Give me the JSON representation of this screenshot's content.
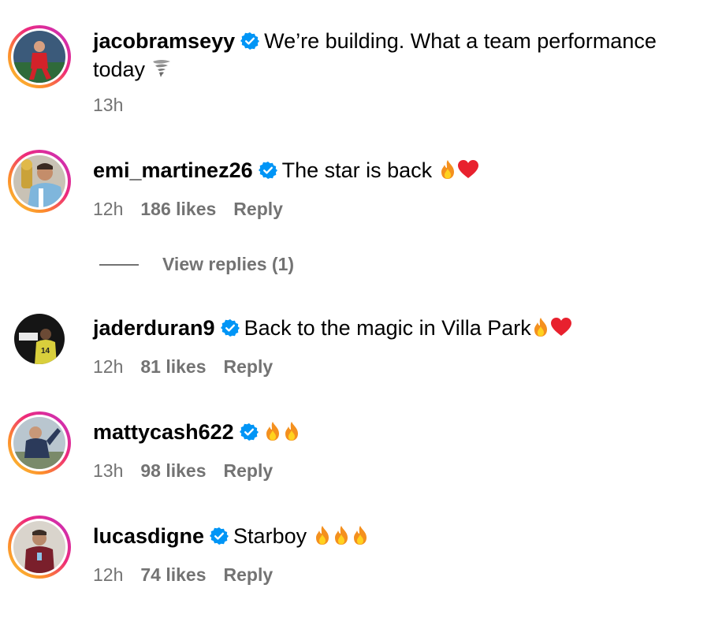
{
  "comments": [
    {
      "username": "jacobramseyy",
      "text": "We’re building. What a team performance",
      "text_cont": "today",
      "trailing_icon": "tornado-icon",
      "time": "13h",
      "likes": "",
      "reply": ""
    },
    {
      "username": "emi_martinez26",
      "text": "The star is back",
      "trailing_icons": [
        "fire-emoji",
        "red-heart-emoji"
      ],
      "time": "12h",
      "likes": "186 likes",
      "reply": "Reply"
    },
    {
      "username": "jaderduran9",
      "text": "Back to the magic in Villa Park",
      "trailing_icons": [
        "fire-emoji",
        "red-heart-emoji"
      ],
      "time": "12h",
      "likes": "81 likes",
      "reply": "Reply"
    },
    {
      "username": "mattycash622",
      "text": "",
      "trailing_icons": [
        "fire-emoji",
        "fire-emoji"
      ],
      "time": "13h",
      "likes": "98 likes",
      "reply": "Reply"
    },
    {
      "username": "lucasdigne",
      "text": "Starboy",
      "trailing_icons": [
        "fire-emoji",
        "fire-emoji",
        "fire-emoji"
      ],
      "time": "12h",
      "likes": "74 likes",
      "reply": "Reply"
    }
  ],
  "view_replies": "View replies (1)",
  "colors": {
    "secondary_text": "#737373",
    "verified_blue": "#0095f6",
    "story_ring": [
      "#f9ce34",
      "#ee2a7b",
      "#c231c7"
    ]
  }
}
